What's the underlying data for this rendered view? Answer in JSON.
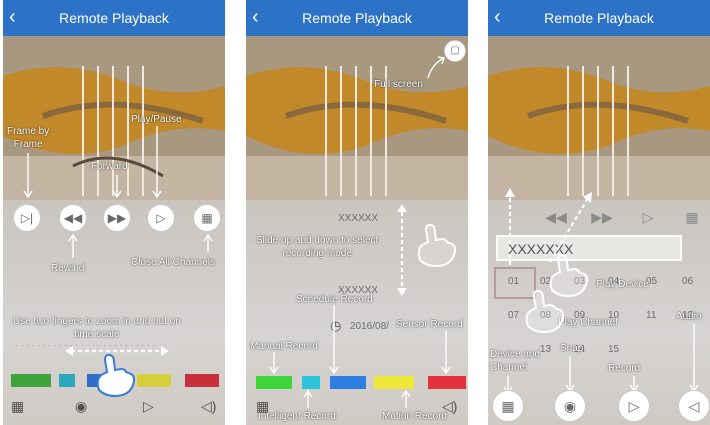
{
  "header": {
    "title": "Remote Playback",
    "back_icon": "chevron-left-icon"
  },
  "panel1": {
    "annotations": {
      "frame_by_frame": "Frame by\nFrame",
      "play_pause": "Play/Pause",
      "forward": "Forward",
      "rewind": "Rewind",
      "close_all": "Close All Channels",
      "zoom": "Use two fingers to zoom in and out on\ntime scale"
    },
    "bottom_icons": [
      "grid-icon",
      "camera-icon",
      "record-icon",
      "volume-icon"
    ]
  },
  "panel2": {
    "annotations": {
      "full_screen": "Full screen",
      "slide": "Slide up and down to select\nrecording mode",
      "schedule": "Schedule Record",
      "manual": "Manual Record",
      "sensor": "Sensor Record",
      "intelligent": "Intelligent Record",
      "motion": "Motion Record"
    },
    "mode_texts": [
      "XXXXXX",
      "XXXXXX"
    ],
    "date_text": "2016/08/",
    "colors": {
      "manual": "#3fd43a",
      "intelligent": "#2ec4dc",
      "schedule": "#2f7fe3",
      "motion": "#f0e73b",
      "sensor": "#e3323c"
    }
  },
  "panel3": {
    "device_value": "XXXXXXX",
    "channel_numbers": [
      "01",
      "02",
      "03",
      "04",
      "05",
      "06",
      "07",
      "08",
      "09",
      "10",
      "11",
      "12",
      "13",
      "14",
      "15"
    ],
    "annotations": {
      "play_device": "Play Device",
      "play_channel": "Play Channel",
      "audio": "Audio",
      "device_channel": "Device and\nChannel",
      "snap": "Snap",
      "record": "Record"
    }
  }
}
